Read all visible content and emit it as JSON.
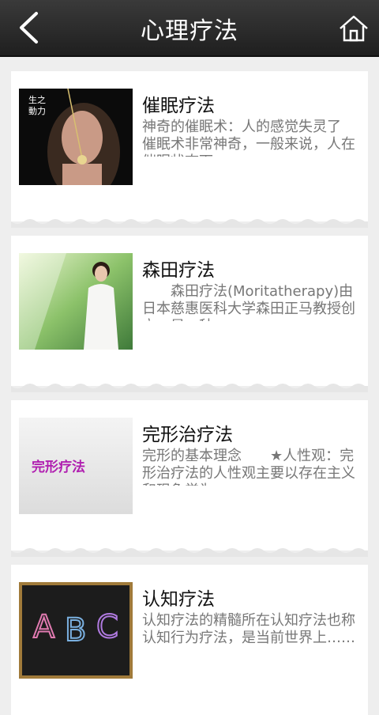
{
  "header": {
    "title": "心理疗法"
  },
  "items": [
    {
      "title": "催眠疗法",
      "desc": "神奇的催眠术：人的感觉失灵了　　催眠术非常神奇，一般来说，人在催眠状态下……",
      "badge": "生之\n動力"
    },
    {
      "title": "森田疗法",
      "desc": "　　森田疗法(Moritatherapy)由日本慈惠医科大学森田正马教授创立，是一种……"
    },
    {
      "title": "完形治疗法",
      "desc": "完形的基本理念　　★人性观：完形治疗法的人性观主要以存在主义和现象学为……",
      "thumb_text": "完形疗法"
    },
    {
      "title": "认知疗法",
      "desc": "认知疗法的精髓所在认知疗法也称认知行为疗法，是当前世界上……"
    }
  ],
  "colors": {
    "bar": "#2b2b2b",
    "bg": "#eeeeee",
    "desc": "#777777"
  }
}
